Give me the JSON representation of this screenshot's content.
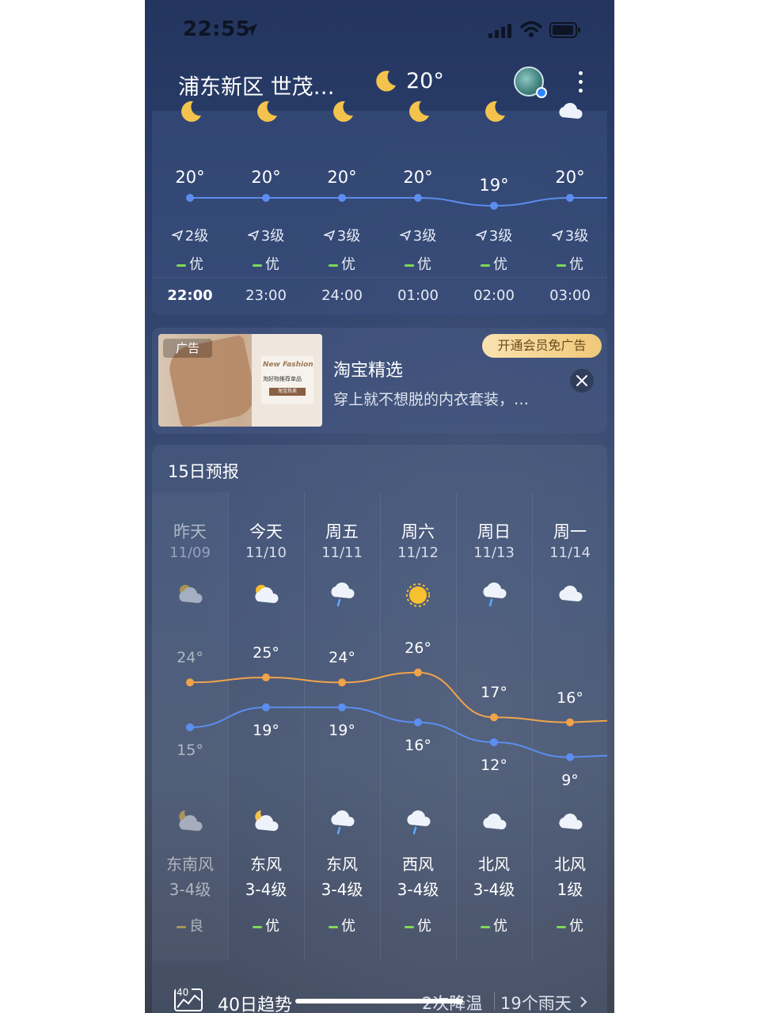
{
  "status_bar": {
    "time": "22:55"
  },
  "header": {
    "location": "浦东新区 世茂…",
    "current_temp": "20°"
  },
  "hourly": {
    "items": [
      {
        "time": "22:00",
        "temp": "20°",
        "wind": "2级",
        "aqi": "优",
        "icon": "moon-icon",
        "now": true
      },
      {
        "time": "23:00",
        "temp": "20°",
        "wind": "3级",
        "aqi": "优",
        "icon": "moon-icon"
      },
      {
        "time": "24:00",
        "temp": "20°",
        "wind": "3级",
        "aqi": "优",
        "icon": "moon-icon"
      },
      {
        "time": "01:00",
        "temp": "20°",
        "wind": "3级",
        "aqi": "优",
        "icon": "moon-icon"
      },
      {
        "time": "02:00",
        "temp": "19°",
        "wind": "3级",
        "aqi": "优",
        "icon": "moon-icon"
      },
      {
        "time": "03:00",
        "temp": "20°",
        "wind": "3级",
        "aqi": "优",
        "icon": "cloud-icon"
      }
    ],
    "temps": [
      20,
      20,
      20,
      20,
      19,
      20
    ]
  },
  "ad": {
    "tag": "广告",
    "title": "淘宝精选",
    "desc": "穿上就不想脱的内衣套装，…",
    "vip_label": "开通会员免广告",
    "img_title": "New Fashion",
    "img_sub": "淘好物推荐单品",
    "img_btn": "淘宝热卖"
  },
  "daily": {
    "title": "15日预报",
    "days": [
      {
        "name": "昨天",
        "date": "11/09",
        "hi": "24°",
        "lo": "15°",
        "wdir": "东南风",
        "wlev": "3-4级",
        "aqi": "良",
        "aqi_color": "#f2c744",
        "day_icon": "partly-cloudy-day-icon",
        "night_icon": "partly-cloudy-night-icon",
        "past": true
      },
      {
        "name": "今天",
        "date": "11/10",
        "hi": "25°",
        "lo": "19°",
        "wdir": "东风",
        "wlev": "3-4级",
        "aqi": "优",
        "aqi_color": "#7ed957",
        "day_icon": "partly-cloudy-day-icon",
        "night_icon": "partly-cloudy-night-icon"
      },
      {
        "name": "周五",
        "date": "11/11",
        "hi": "24°",
        "lo": "19°",
        "wdir": "东风",
        "wlev": "3-4级",
        "aqi": "优",
        "aqi_color": "#7ed957",
        "day_icon": "light-rain-icon",
        "night_icon": "light-rain-icon"
      },
      {
        "name": "周六",
        "date": "11/12",
        "hi": "26°",
        "lo": "16°",
        "wdir": "西风",
        "wlev": "3-4级",
        "aqi": "优",
        "aqi_color": "#7ed957",
        "day_icon": "sunny-icon",
        "night_icon": "light-rain-icon"
      },
      {
        "name": "周日",
        "date": "11/13",
        "hi": "17°",
        "lo": "12°",
        "wdir": "北风",
        "wlev": "3-4级",
        "aqi": "优",
        "aqi_color": "#7ed957",
        "day_icon": "light-rain-icon",
        "night_icon": "cloud-icon"
      },
      {
        "name": "周一",
        "date": "11/14",
        "hi": "16°",
        "lo": "9°",
        "wdir": "北风",
        "wlev": "1级",
        "aqi": "优",
        "aqi_color": "#7ed957",
        "day_icon": "cloud-icon",
        "night_icon": "cloud-icon"
      }
    ],
    "highs": [
      24,
      25,
      24,
      26,
      17,
      16
    ],
    "lows": [
      15,
      19,
      19,
      16,
      12,
      9
    ]
  },
  "trend": {
    "icon_num": "40",
    "label": "40日趋势",
    "rain_summary": "2次降温",
    "rain_days": "19个雨天"
  },
  "colors": {
    "high_line": "#f0a34a",
    "low_line": "#5b8ef0",
    "hourly_line": "#5b8ef0",
    "aqi_good": "#7ed957"
  }
}
